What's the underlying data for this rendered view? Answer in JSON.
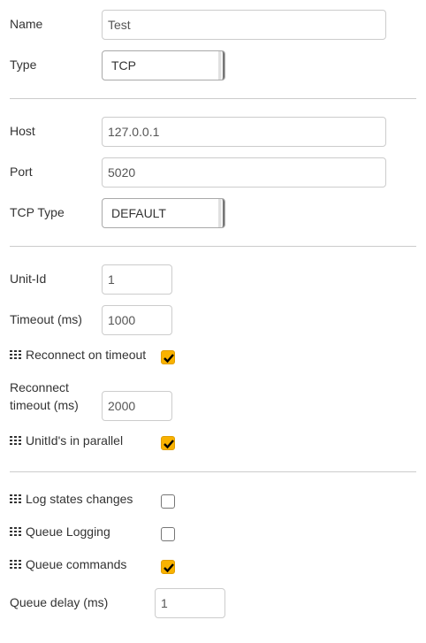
{
  "form": {
    "name": {
      "label": "Name",
      "value": "Test"
    },
    "type": {
      "label": "Type",
      "value": "TCP"
    },
    "host": {
      "label": "Host",
      "value": "127.0.0.1"
    },
    "port": {
      "label": "Port",
      "value": "5020"
    },
    "tcp_type": {
      "label": "TCP Type",
      "value": "DEFAULT"
    },
    "unit_id": {
      "label": "Unit-Id",
      "value": "1"
    },
    "timeout": {
      "label": "Timeout (ms)",
      "value": "1000"
    },
    "reconnect_on_timeout": {
      "label": "Reconnect on timeout",
      "checked": true
    },
    "reconnect_timeout": {
      "label": "Reconnect timeout (ms)",
      "value": "2000"
    },
    "unitids_parallel": {
      "label": "UnitId's in parallel",
      "checked": true
    },
    "log_state_changes": {
      "label": "Log states changes",
      "checked": false
    },
    "queue_logging": {
      "label": "Queue Logging",
      "checked": false
    },
    "queue_commands": {
      "label": "Queue commands",
      "checked": true
    },
    "queue_delay": {
      "label": "Queue delay (ms)",
      "value": "1"
    }
  },
  "icons": {
    "checkbox_row_icon": "grid-icon",
    "check_mark": "check-icon"
  },
  "colors": {
    "checkbox_checked_fill": "#f9b200",
    "divider": "#cccccc",
    "label_text": "#333333"
  }
}
